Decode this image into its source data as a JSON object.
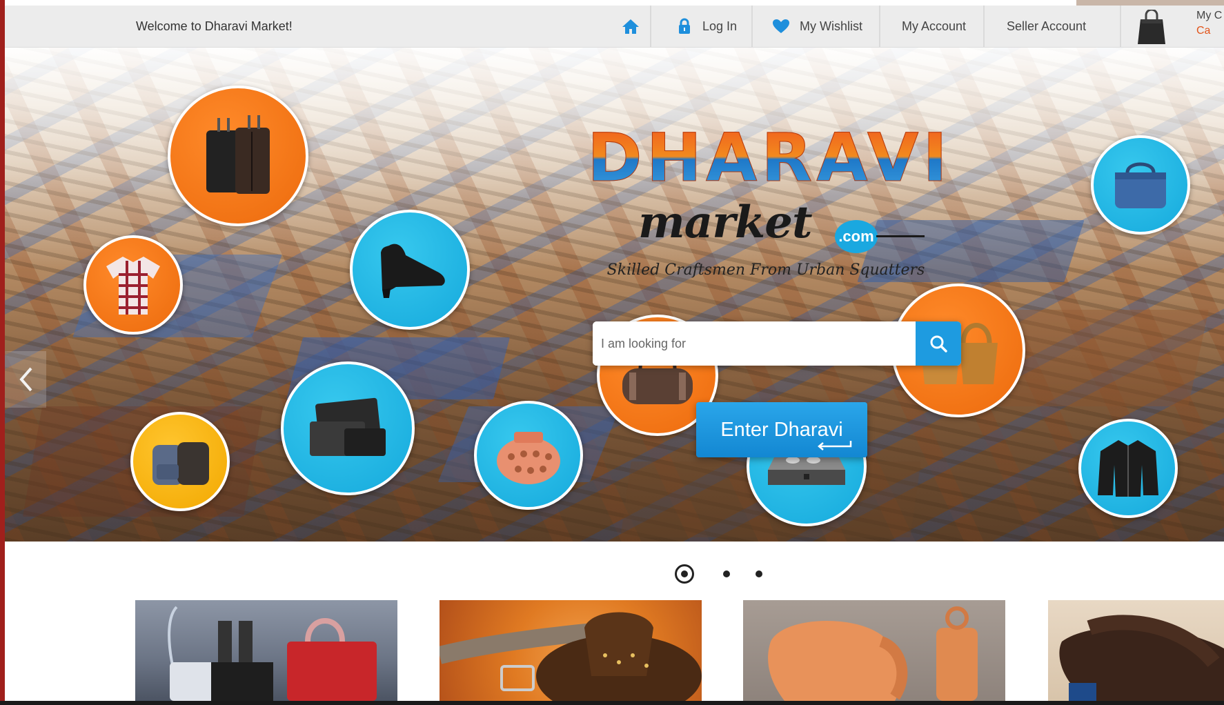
{
  "topbar": {
    "welcome": "Welcome to Dharavi Market!",
    "nav": {
      "home_icon": "home-icon",
      "login_label": "Log In",
      "wishlist_label": "My Wishlist",
      "account_label": "My Account",
      "seller_label": "Seller Account"
    },
    "cart": {
      "line1": "My C",
      "line2": "Ca"
    }
  },
  "hero": {
    "logo_title": "DHARAVI",
    "logo_market": "market",
    "logo_dotcom": ".com",
    "tagline": "Skilled Craftsmen From Urban Squatters",
    "search_placeholder": "I am looking for",
    "enter_label": "Enter Dharavi",
    "products": [
      "luggage",
      "shirt",
      "shoe",
      "handbag-denim",
      "duffel-bag",
      "wicker-bags",
      "wallets",
      "backpacks",
      "terracotta-pot",
      "jewelry-box",
      "leather-jacket"
    ]
  },
  "carousel": {
    "active_index": 0,
    "count": 3
  },
  "colors": {
    "accent_blue": "#1e9be0",
    "accent_orange": "#ec6a0c",
    "topbar_bg": "#ececec"
  }
}
